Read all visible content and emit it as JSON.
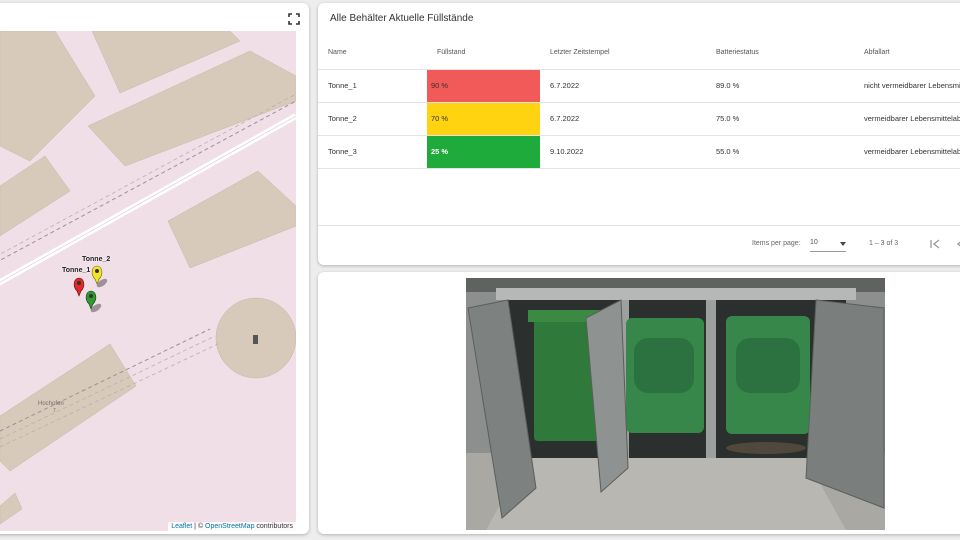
{
  "map": {
    "markers": [
      {
        "label": "Tonne_2",
        "color": "#f5e52a"
      },
      {
        "label": "Tonne_1",
        "color": "#e02a2a"
      },
      {
        "label": "Tonne_3",
        "color": "#2f9a2f"
      }
    ],
    "place_label": "Hochofen",
    "place_sublabel": "7",
    "attribution": {
      "leaflet": "Leaflet",
      "sep": " | © ",
      "osm": "OpenStreetMap",
      "suffix": " contributors"
    }
  },
  "table": {
    "title": "Alle Behälter Aktuelle Füllstände",
    "columns": [
      "Name",
      "Füllstand",
      "Letzter Zeitstempel",
      "Batteriestatus",
      "Abfallart"
    ],
    "rows": [
      {
        "name": "Tonne_1",
        "fill": "90 %",
        "fill_color": "#f25959",
        "timestamp": "6.7.2022",
        "battery": "89.0 %",
        "waste": "nicht vermeidbarer Lebensmittelabfall"
      },
      {
        "name": "Tonne_2",
        "fill": "70 %",
        "fill_color": "#ffd310",
        "timestamp": "6.7.2022",
        "battery": "75.0 %",
        "waste": "vermeidbarer Lebensmittelabfall"
      },
      {
        "name": "Tonne_3",
        "fill": "25 %",
        "fill_color": "#1faa3c",
        "timestamp": "9.10.2022",
        "battery": "55.0 %",
        "waste": "vermeidbarer Lebensmittelabfall"
      }
    ],
    "paginator": {
      "items_per_page_label": "Items per page:",
      "items_per_page_value": "10",
      "range": "1 – 3 of 3"
    }
  },
  "icons": {
    "fullscreen": "fullscreen-icon",
    "first_page": "first-page-icon",
    "prev_page": "chevron-left-icon",
    "dropdown": "caret-down-icon"
  },
  "photo": {
    "subject": "green waste bins in metal enclosure"
  }
}
